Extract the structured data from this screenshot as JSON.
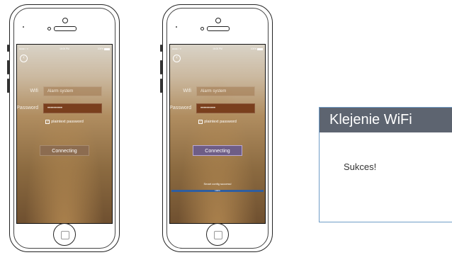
{
  "phone1": {
    "status": {
      "time": "16:00 PM",
      "battery": "100%"
    },
    "wifi_label": "Wifi",
    "wifi_value": "Alarm system",
    "password_label": "Password",
    "password_value": "••••••••••",
    "checkbox_label": "plaintext password",
    "connect_label": "Connecting"
  },
  "phone2": {
    "status": {
      "time": "16:00 PM",
      "battery": "100%"
    },
    "wifi_label": "Wifi",
    "wifi_value": "Alarm system",
    "password_label": "Password",
    "password_value": "••••••••••",
    "checkbox_label": "plaintext password",
    "connect_label": "Connecting",
    "success_text": "Smart config success!",
    "progress_text": "100%",
    "progress": 1.0
  },
  "dialog": {
    "title": "Klejenie WiFi",
    "message": "Sukces!"
  },
  "colors": {
    "dialog_header": "#5d6470",
    "dialog_border": "#6f9cc7",
    "password_field": "#7a3f1d",
    "connect_pressed": "#6e5d86",
    "progress_fill": "#2f5ea0"
  }
}
